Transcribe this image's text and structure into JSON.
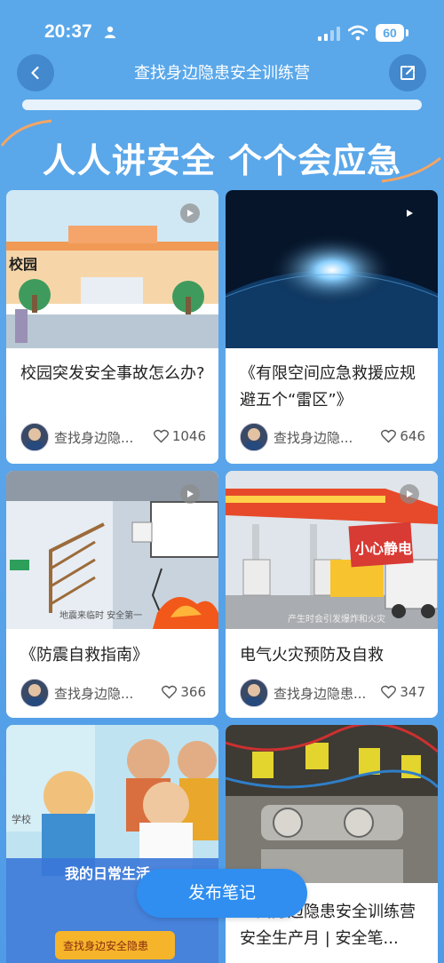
{
  "status_bar": {
    "time": "20:37",
    "battery": "60"
  },
  "nav": {
    "title": "查找身边隐患安全训练营",
    "back_icon": "chevron-left-icon",
    "share_icon": "share-icon"
  },
  "hero": {
    "slogan": "人人讲安全 个个会应急"
  },
  "cards": [
    {
      "title": "校园突发安全事故怎么办?",
      "author": "查找身边隐...",
      "likes": "1046",
      "thumb_text": "校园"
    },
    {
      "title": "《有限空间应急救援应规避五个“雷区”》",
      "author": "查找身边隐...",
      "likes": "646"
    },
    {
      "title": "《防震自救指南》",
      "author": "查找身边隐...",
      "likes": "366",
      "thumb_caption": "地震来临时 安全第一"
    },
    {
      "title": "电气火灾预防及自救",
      "author": "查找身边隐患...",
      "likes": "347",
      "thumb_sign": "小心静电",
      "thumb_caption": "产生时会引发爆炸和火灾"
    },
    {
      "title": "",
      "author": "",
      "likes": "",
      "thumb_banner": "我的日常生活",
      "thumb_button": "查找身边安全隐患",
      "thumb_label": "学校"
    },
    {
      "title": "查找身边隐患安全训练营 安全生产月 | 安全笔...",
      "author": "",
      "likes": ""
    }
  ],
  "publish_button": {
    "label": "发布笔记"
  }
}
